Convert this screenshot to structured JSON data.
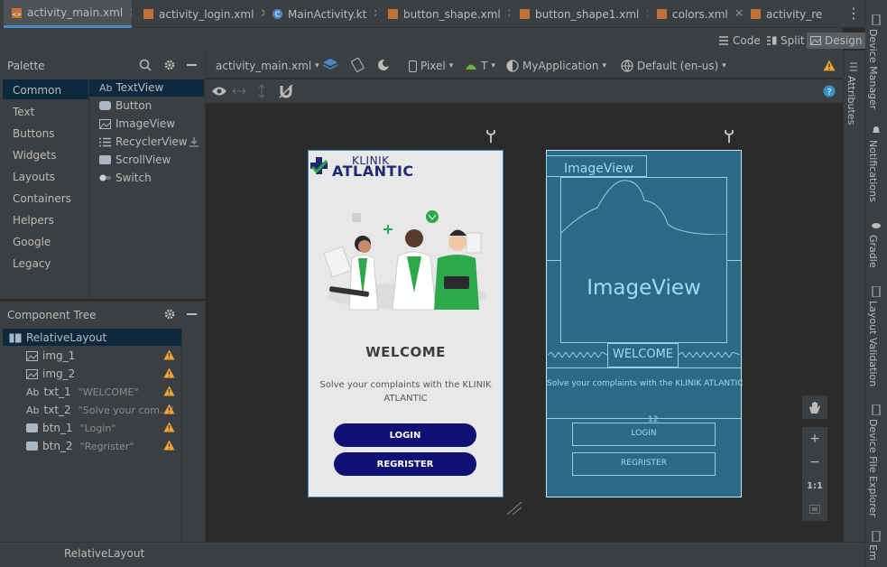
{
  "tabs": [
    {
      "label": "activity_main.xml",
      "active": true
    },
    {
      "label": "activity_login.xml"
    },
    {
      "label": "MainActivity.kt"
    },
    {
      "label": "button_shape.xml"
    },
    {
      "label": "button_shape1.xml"
    },
    {
      "label": "colors.xml"
    },
    {
      "label": "activity_re"
    }
  ],
  "tab_more_label": "⋮",
  "modes": {
    "code": "Code",
    "split": "Split",
    "design": "Design"
  },
  "palette": {
    "title": "Palette",
    "categories": [
      "Common",
      "Text",
      "Buttons",
      "Widgets",
      "Layouts",
      "Containers",
      "Helpers",
      "Google",
      "Legacy"
    ],
    "widgets": [
      {
        "prefix": "Ab",
        "label": "TextView"
      },
      {
        "label": "Button"
      },
      {
        "label": "ImageView"
      },
      {
        "label": "RecyclerView"
      },
      {
        "label": "ScrollView"
      },
      {
        "label": "Switch"
      }
    ]
  },
  "component_tree": {
    "title": "Component Tree",
    "root": "RelativeLayout",
    "nodes": [
      {
        "prefix": "",
        "label": "img_1",
        "attr": ""
      },
      {
        "prefix": "",
        "label": "img_2",
        "attr": ""
      },
      {
        "prefix": "Ab",
        "label": "txt_1",
        "attr": "\"WELCOME\""
      },
      {
        "prefix": "Ab",
        "label": "txt_2",
        "attr": "\"Solve your com...\""
      },
      {
        "prefix": "",
        "label": "btn_1",
        "attr": "\"Login\""
      },
      {
        "prefix": "",
        "label": "btn_2",
        "attr": "\"Regrister\""
      }
    ]
  },
  "design_toolbar": {
    "file": "activity_main.xml",
    "device": "Pixel",
    "api": "T",
    "theme": "MyApplication",
    "locale": "Default (en-us)"
  },
  "phone": {
    "logo_top": "KLINIK",
    "logo_bottom": "ATLANTIC",
    "welcome": "WELCOME",
    "subtitle": "Solve your complaints with the KLINIK ATLANTIC",
    "login": "LOGIN",
    "register": "REGRISTER"
  },
  "blueprint": {
    "imageview_small": "ImageView",
    "imageview_big": "ImageView",
    "welcome": "WELCOME",
    "subtitle": "Solve your complaints with the KLINIK ATLANTIC",
    "login": "LOGIN",
    "register": "REGRISTER",
    "margin_label": "12"
  },
  "zoom": {
    "plus": "+",
    "minus": "−",
    "one_to_one": "1:1"
  },
  "right_stripe": [
    "Device Manager",
    "Notifications",
    "Gradle",
    "Layout Validation",
    "Device File Explorer",
    "Em"
  ],
  "attributes_label": "Attributes",
  "status": "RelativeLayout",
  "colors": {
    "accent": "#4a88c7",
    "warning": "#f0a732",
    "brand": "#1d2a6e",
    "button": "#0f0f74",
    "blueprint": "#2b6a86"
  }
}
